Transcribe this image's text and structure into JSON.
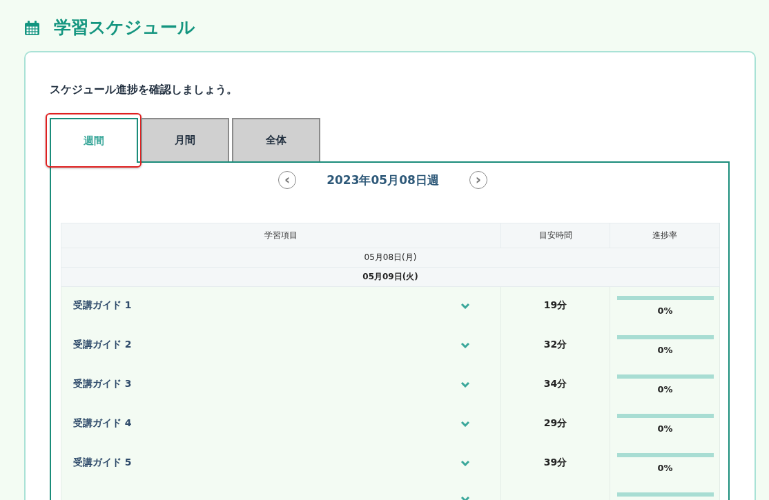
{
  "page": {
    "title": "学習スケジュール"
  },
  "intro": "スケジュール進捗を確認しましょう。",
  "tabs": [
    {
      "label": "週間",
      "selected": true,
      "highlighted": true
    },
    {
      "label": "月間",
      "selected": false,
      "highlighted": false
    },
    {
      "label": "全体",
      "selected": false,
      "highlighted": false
    }
  ],
  "week_nav": {
    "prev": "‹",
    "label": "2023年05月08日週",
    "next": "›"
  },
  "table": {
    "columns": [
      "学習項目",
      "目安時間",
      "進捗率"
    ],
    "days": [
      {
        "date": "05月08日(月)",
        "bold": false
      },
      {
        "date": "05月09日(火)",
        "bold": true,
        "rows": [
          {
            "item": "受講ガイド 1",
            "time": "19分",
            "level": 0,
            "progress": "0%"
          },
          {
            "item": "受講ガイド 2",
            "time": "32分",
            "level": 0,
            "progress": "0%"
          },
          {
            "item": "受講ガイド 3",
            "time": "34分",
            "level": 0,
            "progress": "0%"
          },
          {
            "item": "受講ガイド 4",
            "time": "29分",
            "level": 0,
            "progress": "0%"
          },
          {
            "item": "受講ガイド 5",
            "time": "39分",
            "level": 0,
            "progress": "0%"
          },
          {
            "level": 0
          }
        ]
      }
    ]
  }
}
